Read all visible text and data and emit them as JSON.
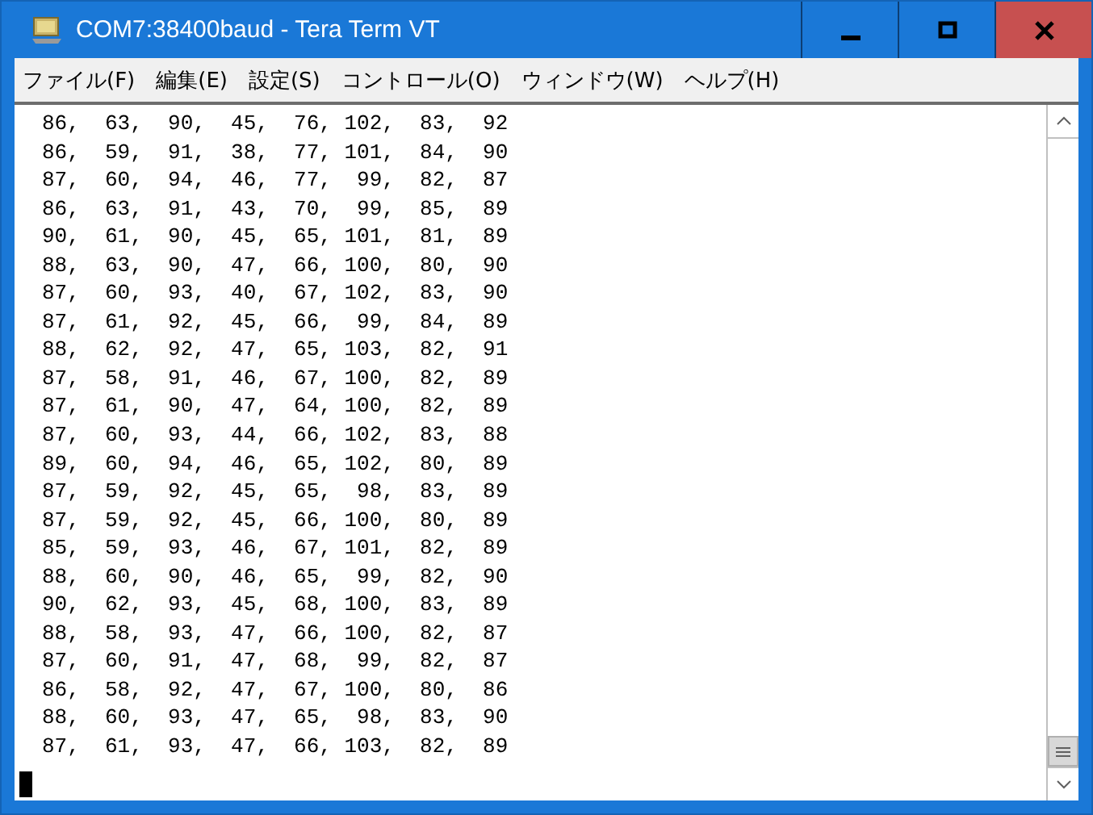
{
  "window": {
    "title": "COM7:38400baud - Tera Term VT"
  },
  "menu": [
    "ファイル(F)",
    "編集(E)",
    "設定(S)",
    "コントロール(O)",
    "ウィンドウ(W)",
    "ヘルプ(H)"
  ],
  "terminal": {
    "lines": [
      "86,  63,  90,  45,  76, 102,  83,  92",
      "86,  59,  91,  38,  77, 101,  84,  90",
      "87,  60,  94,  46,  77,  99,  82,  87",
      "86,  63,  91,  43,  70,  99,  85,  89",
      "90,  61,  90,  45,  65, 101,  81,  89",
      "88,  63,  90,  47,  66, 100,  80,  90",
      "87,  60,  93,  40,  67, 102,  83,  90",
      "87,  61,  92,  45,  66,  99,  84,  89",
      "88,  62,  92,  47,  65, 103,  82,  91",
      "87,  58,  91,  46,  67, 100,  82,  89",
      "87,  61,  90,  47,  64, 100,  82,  89",
      "87,  60,  93,  44,  66, 102,  83,  88",
      "89,  60,  94,  46,  65, 102,  80,  89",
      "87,  59,  92,  45,  65,  98,  83,  89",
      "87,  59,  92,  45,  66, 100,  80,  89",
      "85,  59,  93,  46,  67, 101,  82,  89",
      "88,  60,  90,  46,  65,  99,  82,  90",
      "90,  62,  93,  45,  68, 100,  83,  89",
      "88,  58,  93,  47,  66, 100,  82,  87",
      "87,  60,  91,  47,  68,  99,  82,  87",
      "86,  58,  92,  47,  67, 100,  80,  86",
      "88,  60,  93,  47,  65,  98,  83,  90",
      "87,  61,  93,  47,  66, 103,  82,  89"
    ]
  }
}
